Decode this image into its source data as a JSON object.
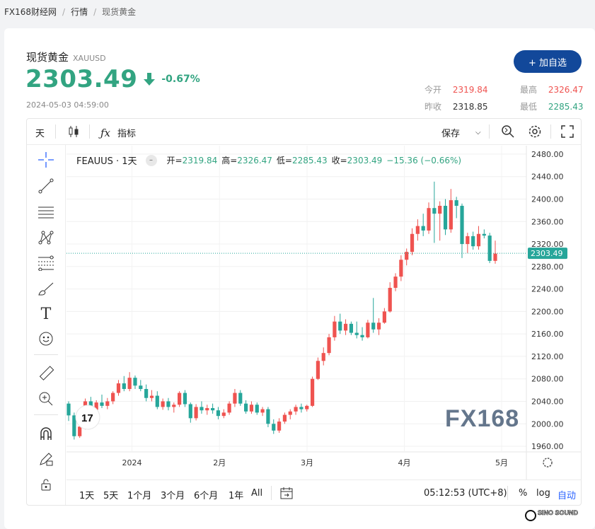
{
  "breadcrumb": [
    "FX168财经网",
    "行情",
    "现货黄金"
  ],
  "quote": {
    "name": "现货黄金",
    "code": "XAUUSD",
    "price": "2303.49",
    "change_pct": "-0.67%",
    "timestamp": "2024-05-03 04:59:00",
    "add_button": "+ 加自选",
    "open_label": "今开",
    "open": "2319.84",
    "high_label": "最高",
    "high": "2326.47",
    "prev_label": "昨收",
    "prev": "2318.85",
    "low_label": "最低",
    "low": "2285.43"
  },
  "toolbar": {
    "interval": "天",
    "indicators": "指标",
    "save": "保存"
  },
  "legend": {
    "symbol": "FEAUUS · 1天",
    "open_k": "开=",
    "open_v": "2319.84",
    "high_k": "高=",
    "high_v": "2326.47",
    "low_k": "低=",
    "low_v": "2285.43",
    "close_k": "收=",
    "close_v": "2303.49",
    "change_v": "−15.36 (−0.66%)"
  },
  "watermark": "FX168",
  "corner_logo": "SINO SOUND",
  "bottom": {
    "ranges": [
      "1天",
      "5天",
      "1个月",
      "3个月",
      "6个月",
      "1年",
      "All"
    ],
    "clock": "05:12:53 (UTC+8)",
    "pct": "%",
    "log": "log",
    "auto": "自动"
  },
  "colors": {
    "up": "#ef5350",
    "down": "#26a69a",
    "price_green": "#32a481",
    "button": "#12489a"
  },
  "chart_data": {
    "type": "candlestick",
    "y_ticks": [
      "2480.00",
      "2440.00",
      "2400.00",
      "2360.00",
      "2320.00",
      "2280.00",
      "2240.00",
      "2200.00",
      "2160.00",
      "2120.00",
      "2080.00",
      "2040.00",
      "2000.00",
      "1960.00"
    ],
    "ylim": [
      1950,
      2495
    ],
    "x_labels": [
      "2024",
      "2月",
      "3月",
      "4月",
      "5月"
    ],
    "last_price_label": "2303.49",
    "last_price": 2303.49,
    "candles": [
      [
        2036,
        2040,
        2005,
        2015
      ],
      [
        2015,
        2020,
        1972,
        1978
      ],
      [
        1978,
        2000,
        1975,
        1995
      ],
      [
        1995,
        2045,
        1990,
        2040
      ],
      [
        2040,
        2048,
        2020,
        2025
      ],
      [
        2025,
        2042,
        2022,
        2038
      ],
      [
        2038,
        2052,
        2028,
        2032
      ],
      [
        2032,
        2046,
        2026,
        2040
      ],
      [
        2040,
        2058,
        2035,
        2055
      ],
      [
        2055,
        2078,
        2050,
        2072
      ],
      [
        2072,
        2085,
        2058,
        2062
      ],
      [
        2062,
        2092,
        2058,
        2082
      ],
      [
        2082,
        2086,
        2062,
        2068
      ],
      [
        2068,
        2078,
        2058,
        2062
      ],
      [
        2062,
        2070,
        2040,
        2046
      ],
      [
        2046,
        2060,
        2040,
        2050
      ],
      [
        2050,
        2058,
        2026,
        2030
      ],
      [
        2030,
        2045,
        2025,
        2040
      ],
      [
        2040,
        2046,
        2024,
        2030
      ],
      [
        2030,
        2038,
        2020,
        2034
      ],
      [
        2034,
        2058,
        2030,
        2055
      ],
      [
        2055,
        2060,
        2030,
        2035
      ],
      [
        2035,
        2038,
        2002,
        2010
      ],
      [
        2010,
        2035,
        2006,
        2030
      ],
      [
        2030,
        2040,
        2018,
        2024
      ],
      [
        2024,
        2034,
        2016,
        2028
      ],
      [
        2028,
        2036,
        2018,
        2024
      ],
      [
        2024,
        2030,
        2008,
        2014
      ],
      [
        2014,
        2026,
        2010,
        2020
      ],
      [
        2020,
        2040,
        2016,
        2036
      ],
      [
        2036,
        2062,
        2030,
        2055
      ],
      [
        2055,
        2060,
        2032,
        2036
      ],
      [
        2036,
        2042,
        2018,
        2022
      ],
      [
        2022,
        2040,
        2018,
        2034
      ],
      [
        2034,
        2038,
        2016,
        2020
      ],
      [
        2020,
        2030,
        2014,
        2026
      ],
      [
        2026,
        2030,
        1994,
        2000
      ],
      [
        2000,
        2008,
        1982,
        1988
      ],
      [
        1988,
        2010,
        1984,
        2004
      ],
      [
        2004,
        2020,
        2000,
        2016
      ],
      [
        2016,
        2026,
        2008,
        2022
      ],
      [
        2022,
        2034,
        2016,
        2030
      ],
      [
        2030,
        2036,
        2020,
        2026
      ],
      [
        2026,
        2034,
        2022,
        2032
      ],
      [
        2032,
        2084,
        2030,
        2080
      ],
      [
        2080,
        2118,
        2078,
        2112
      ],
      [
        2112,
        2136,
        2104,
        2126
      ],
      [
        2126,
        2160,
        2122,
        2154
      ],
      [
        2154,
        2192,
        2148,
        2182
      ],
      [
        2182,
        2196,
        2160,
        2166
      ],
      [
        2166,
        2186,
        2158,
        2178
      ],
      [
        2178,
        2182,
        2158,
        2162
      ],
      [
        2162,
        2182,
        2152,
        2158
      ],
      [
        2158,
        2172,
        2148,
        2154
      ],
      [
        2154,
        2185,
        2152,
        2180
      ],
      [
        2180,
        2224,
        2162,
        2168
      ],
      [
        2168,
        2188,
        2158,
        2180
      ],
      [
        2180,
        2206,
        2178,
        2200
      ],
      [
        2200,
        2252,
        2198,
        2242
      ],
      [
        2242,
        2268,
        2236,
        2262
      ],
      [
        2262,
        2300,
        2254,
        2292
      ],
      [
        2292,
        2312,
        2282,
        2306
      ],
      [
        2306,
        2348,
        2300,
        2338
      ],
      [
        2338,
        2364,
        2326,
        2352
      ],
      [
        2352,
        2374,
        2334,
        2344
      ],
      [
        2344,
        2394,
        2338,
        2384
      ],
      [
        2384,
        2431,
        2322,
        2374
      ],
      [
        2374,
        2396,
        2326,
        2388
      ],
      [
        2388,
        2400,
        2336,
        2346
      ],
      [
        2346,
        2418,
        2340,
        2398
      ],
      [
        2398,
        2404,
        2366,
        2388
      ],
      [
        2388,
        2392,
        2295,
        2320
      ],
      [
        2320,
        2340,
        2304,
        2334
      ],
      [
        2334,
        2342,
        2310,
        2316
      ],
      [
        2316,
        2352,
        2310,
        2338
      ],
      [
        2338,
        2346,
        2330,
        2335
      ],
      [
        2335,
        2340,
        2286,
        2290
      ],
      [
        2290,
        2326,
        2285,
        2303
      ]
    ]
  }
}
